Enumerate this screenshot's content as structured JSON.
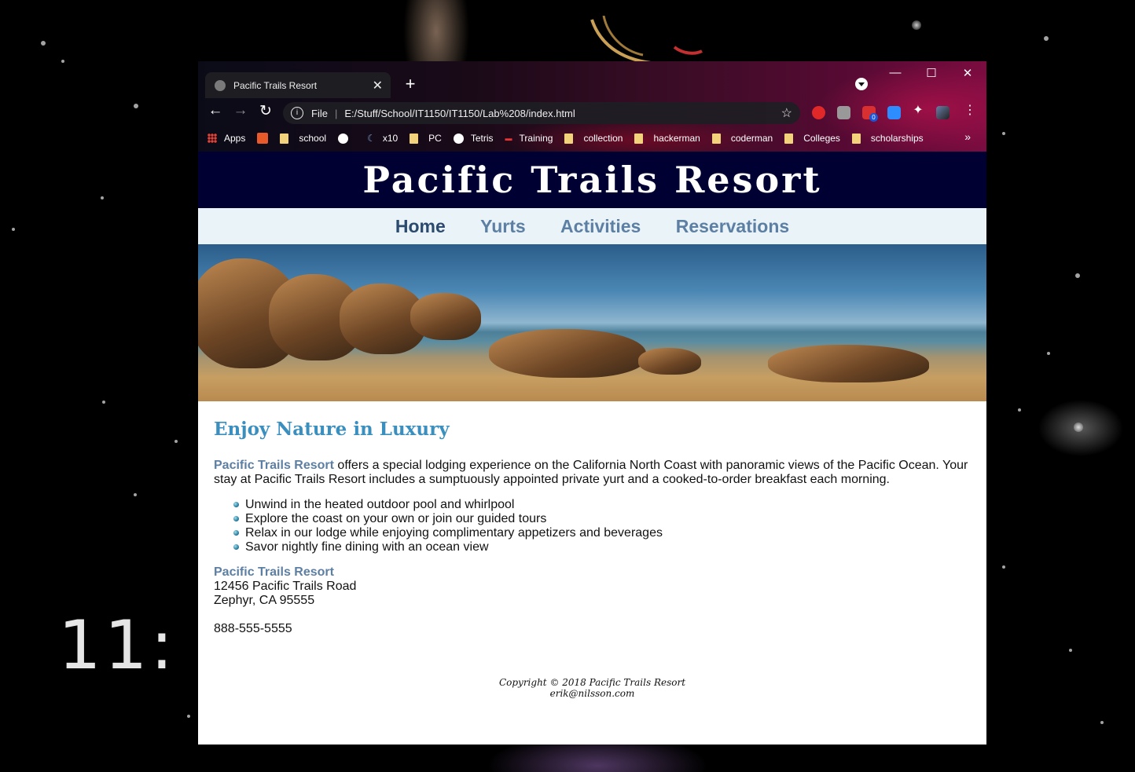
{
  "desktop": {
    "clock": "11:"
  },
  "browser": {
    "tab_title": "Pacific Trails Resort",
    "address": {
      "protocol_label": "File",
      "url": "E:/Stuff/School/IT1150/IT1150/Lab%208/index.html"
    },
    "bookmarks": [
      "Apps",
      "school",
      "x10",
      "PC",
      "Tetris",
      "Training",
      "collection",
      "hackerman",
      "coderman",
      "Colleges",
      "scholarships"
    ],
    "extension_badge": "0"
  },
  "page": {
    "header": "Pacific Trails Resort",
    "nav": [
      "Home",
      "Yurts",
      "Activities",
      "Reservations"
    ],
    "heading": "Enjoy Nature in Luxury",
    "intro_brand": "Pacific Trails Resort",
    "intro_text": " offers a special lodging experience on the California North Coast with panoramic views of the Pacific Ocean. Your stay at Pacific Trails Resort includes a sumptuously appointed private yurt and a cooked-to-order breakfast each morning.",
    "features": [
      "Unwind in the heated outdoor pool and whirlpool",
      "Explore the coast on your own or join our guided tours",
      "Relax in our lodge while enjoying complimentary appetizers and beverages",
      "Savor nightly fine dining with an ocean view"
    ],
    "contact": {
      "name": "Pacific Trails Resort",
      "street": "12456 Pacific Trails Road",
      "city": "Zephyr, CA 95555",
      "phone": "888-555-5555"
    },
    "footer": {
      "copyright": "Copyright © 2018 Pacific Trails Resort",
      "email": "erik@nilsson.com"
    }
  },
  "colors": {
    "header_bg": "#000033",
    "nav_bg": "#eaf3f8",
    "heading": "#3a8fbf",
    "brand": "#5c7fa3"
  }
}
